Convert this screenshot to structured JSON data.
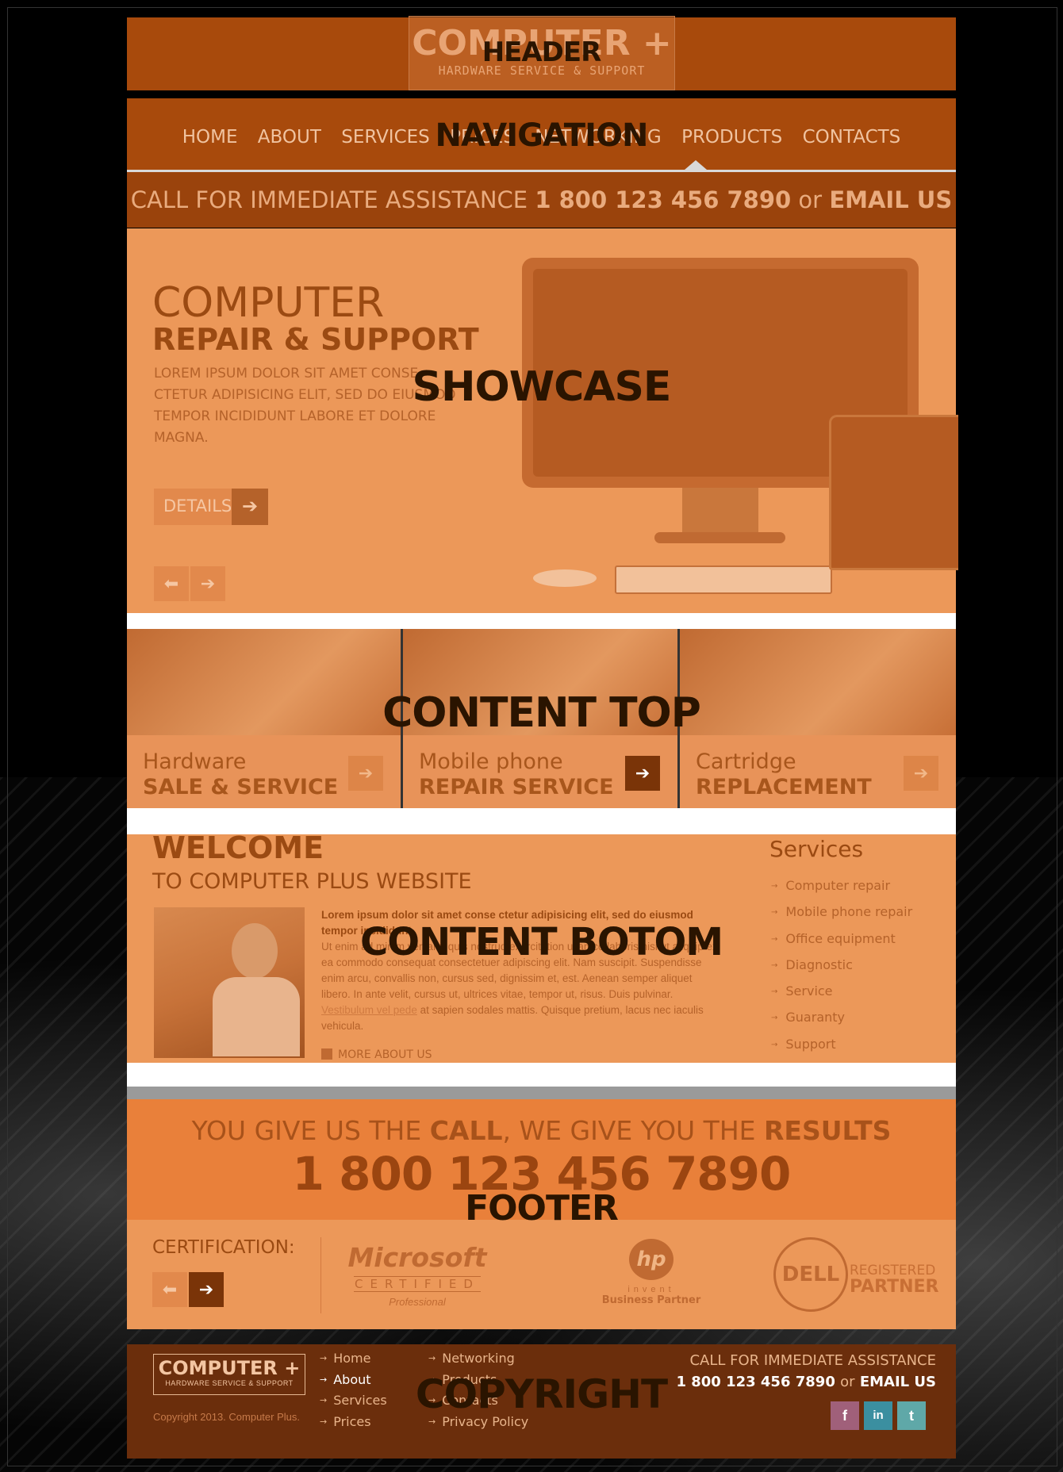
{
  "overlay_labels": {
    "header": "HEADER",
    "navigation": "NAVIGATION",
    "showcase": "SHOWCASE",
    "content_top": "CONTENT TOP",
    "content_bottom": "CONTENT BOTOM",
    "footer": "FOOTER",
    "copyright": "COPYRIGHT"
  },
  "header": {
    "logo_main": "COMPUTER +",
    "logo_sub": "HARDWARE SERVICE & SUPPORT"
  },
  "nav": {
    "items": [
      "HOME",
      "ABOUT",
      "SERVICES",
      "PRICES",
      "NETWORKING",
      "PRODUCTS",
      "CONTACTS"
    ]
  },
  "callbar": {
    "lead": "CALL FOR IMMEDIATE ASSISTANCE",
    "phone": "1 800 123 456 7890",
    "or": "or",
    "email": "EMAIL US"
  },
  "showcase": {
    "title1": "COMPUTER",
    "title2": "REPAIR & SUPPORT",
    "text": "LOREM IPSUM DOLOR SIT AMET CONSE CTETUR ADIPISICING ELIT, SED DO EIUSMOD TEMPOR INCIDIDUNT LABORE ET DOLORE MAGNA.",
    "details": "DETAILS",
    "arrow_right": "➔",
    "arrow_left": "⬅"
  },
  "content_top": {
    "tiles": [
      {
        "line1": "Hardware",
        "line2": "SALE & SERVICE"
      },
      {
        "line1": "Mobile phone",
        "line2": "REPAIR SERVICE"
      },
      {
        "line1": "Cartridge",
        "line2": "REPLACEMENT"
      }
    ]
  },
  "content_bottom": {
    "welcome": "WELCOME",
    "welcome_sub": "TO COMPUTER PLUS WEBSITE",
    "bold_text": "Lorem ipsum dolor sit amet conse ctetur adipisicing elit, sed do eiusmod tempor incididunt.",
    "text_before_link": "Ut enim ad minim veniam, quis nostrud exercitation ullamco laboris nisi ut aliquip ex ea commodo consequat consectetuer adipiscing elit. Nam suscipit. Suspendisse enim arcu, convallis non, cursus sed, dignissim et, est. Aenean semper aliquet libero. In ante velit, cursus ut, ultrices vitae, tempor ut, risus. Duis pulvinar.",
    "link": "Vestibulum vel pede",
    "text_after_link": "at sapien sodales mattis. Quisque pretium, lacus nec iaculis vehicula.",
    "more": "MORE ABOUT US",
    "services_title": "Services",
    "services": [
      "Computer repair",
      "Mobile phone repair",
      "Office equipment",
      "Diagnostic",
      "Service",
      "Guaranty",
      "Support"
    ]
  },
  "footer": {
    "slogan_1": "YOU GIVE US THE",
    "slogan_2": "CALL",
    "slogan_3": ", WE GIVE YOU THE",
    "slogan_4": "RESULTS",
    "phone": "1 800 123 456 7890",
    "certification": "CERTIFICATION:",
    "ms_1": "Microsoft",
    "ms_2": "CERTIFIED",
    "ms_3": "Professional",
    "hp_logo": "hp",
    "hp_1": "invent",
    "hp_2": "Business Partner",
    "dell_logo": "DELL",
    "dell_1": "REGISTERED",
    "dell_2": "PARTNER"
  },
  "copyright": {
    "logo_main": "COMPUTER +",
    "logo_sub": "HARDWARE SERVICE & SUPPORT",
    "text": "Copyright 2013. Computer Plus.",
    "links_col1": [
      "Home",
      "About",
      "Services",
      "Prices"
    ],
    "links_col2": [
      "Networking",
      "Products",
      "Contacts",
      "Privacy Policy"
    ],
    "call_lead": "CALL FOR IMMEDIATE ASSISTANCE",
    "phone": "1 800 123 456 7890",
    "or": "or",
    "email": "EMAIL US",
    "social": [
      "f",
      "in",
      "t"
    ]
  },
  "colors": {
    "orange": "#e9803a",
    "dark_orange": "#a84a0c",
    "brown": "#6b2e0c",
    "facebook": "#a0607a",
    "linkedin": "#3b8fa0",
    "twitter": "#5fa8a8"
  }
}
